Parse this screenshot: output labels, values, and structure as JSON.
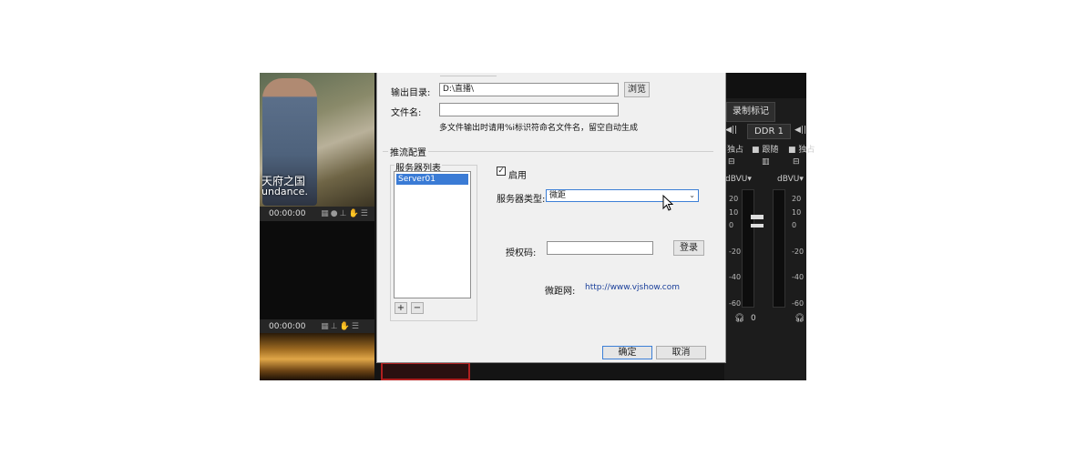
{
  "background_app": {
    "left_panel": {
      "caption_line1": "天府之国",
      "caption_line2": "undance.",
      "timecode_top": "00:00:00",
      "timecode_bottom": "00:00:00"
    },
    "mixer": {
      "record_marker_button": "录制标记",
      "ddr_label": "DDR 1",
      "solo_label": "独占",
      "follow_label": "跟随",
      "solo_label_2": "独占",
      "unit_left": "dBVU▾",
      "unit_right": "dBVU▾",
      "scale_left": [
        "20",
        "10",
        "0",
        "-20",
        "-40",
        "-60"
      ],
      "scale_right": [
        "20",
        "10",
        "0",
        "-20",
        "-40",
        "-60"
      ],
      "gain_value": "0"
    }
  },
  "dialog": {
    "output_dir_label": "输出目录:",
    "output_dir_value": "D:\\直播\\",
    "browse_button": "浏览",
    "filename_label": "文件名:",
    "filename_value": "",
    "filename_hint": "多文件输出时请用%i标识符命名文件名，留空自动生成",
    "streaming_section_title": "推流配置",
    "server_list_title": "服务器列表",
    "server_items": [
      "Server01"
    ],
    "add_button": "+",
    "remove_button": "−",
    "enable_checkbox_label": "启用",
    "enable_checked": true,
    "server_type_label": "服务器类型:",
    "server_type_value": "微距",
    "auth_code_label": "授权码:",
    "auth_code_value": "",
    "login_button": "登录",
    "website_label": "微距网:",
    "website_url": "http://www.vjshow.com",
    "ok_button": "确定",
    "cancel_button": "取消"
  }
}
